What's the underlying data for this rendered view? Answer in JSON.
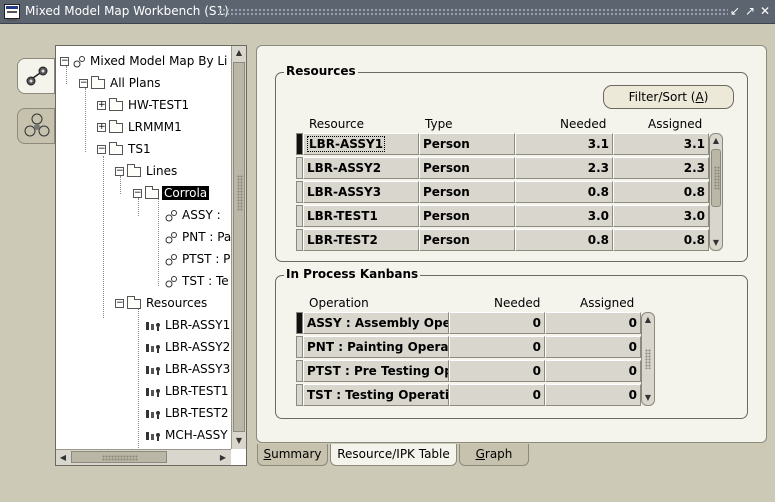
{
  "window": {
    "title": "Mixed Model Map Workbench (S1)",
    "controls": [
      "minimize-icon",
      "maximize-icon",
      "close-icon"
    ]
  },
  "side_strip": [
    {
      "icon": "network-map-icon",
      "selected": true
    },
    {
      "icon": "cluster-map-icon",
      "selected": false
    }
  ],
  "tree": {
    "nodes": [
      {
        "label": "Mixed Model Map By Li",
        "icon": "gear-icon",
        "expander": "-"
      },
      {
        "label": "All Plans",
        "icon": "folder-icon",
        "expander": "-"
      },
      {
        "label": "HW-TEST1",
        "icon": "folder-icon",
        "expander": "+"
      },
      {
        "label": "LRMMM1",
        "icon": "folder-icon",
        "expander": "+"
      },
      {
        "label": "TS1",
        "icon": "folder-icon",
        "expander": "-"
      },
      {
        "label": "Lines",
        "icon": "folder-icon",
        "expander": "-"
      },
      {
        "label": "Corrola",
        "icon": "folder-icon",
        "expander": "-",
        "selected": true
      },
      {
        "label": "ASSY :",
        "icon": "gear-icon"
      },
      {
        "label": "PNT : Pa",
        "icon": "gear-icon"
      },
      {
        "label": "PTST : P",
        "icon": "gear-icon"
      },
      {
        "label": "TST : Te",
        "icon": "gear-icon"
      },
      {
        "label": "Resources",
        "icon": "folder-icon",
        "expander": "-"
      },
      {
        "label": "LBR-ASSY1",
        "icon": "resource-icon"
      },
      {
        "label": "LBR-ASSY2",
        "icon": "resource-icon"
      },
      {
        "label": "LBR-ASSY3",
        "icon": "resource-icon"
      },
      {
        "label": "LBR-TEST1",
        "icon": "resource-icon"
      },
      {
        "label": "LBR-TEST2",
        "icon": "resource-icon"
      },
      {
        "label": "MCH-ASSY",
        "icon": "resource-icon"
      }
    ]
  },
  "resources": {
    "section_label": "Resources",
    "filter_button": "Filter/Sort (A)",
    "filter_button_mnemonic": "A",
    "columns": [
      "Resource",
      "Type",
      "Needed",
      "Assigned"
    ],
    "rows": [
      {
        "resource": "LBR-ASSY1",
        "type": "Person",
        "needed": "3.1",
        "assigned": "3.1"
      },
      {
        "resource": "LBR-ASSY2",
        "type": "Person",
        "needed": "2.3",
        "assigned": "2.3"
      },
      {
        "resource": "LBR-ASSY3",
        "type": "Person",
        "needed": "0.8",
        "assigned": "0.8"
      },
      {
        "resource": "LBR-TEST1",
        "type": "Person",
        "needed": "3.0",
        "assigned": "3.0"
      },
      {
        "resource": "LBR-TEST2",
        "type": "Person",
        "needed": "0.8",
        "assigned": "0.8"
      }
    ]
  },
  "kanbans": {
    "section_label": "In Process Kanbans",
    "columns": [
      "Operation",
      "Needed",
      "Assigned"
    ],
    "rows": [
      {
        "operation": "ASSY : Assembly Oper",
        "needed": "0",
        "assigned": "0"
      },
      {
        "operation": "PNT : Painting Operat",
        "needed": "0",
        "assigned": "0"
      },
      {
        "operation": "PTST : Pre Testing Op",
        "needed": "0",
        "assigned": "0"
      },
      {
        "operation": "TST : Testing Operatic",
        "needed": "0",
        "assigned": "0"
      }
    ]
  },
  "tabs": [
    {
      "label": "Summary",
      "mnemonic": "S",
      "active": false
    },
    {
      "label": "Resource/IPK Table",
      "mnemonic": "",
      "active": true
    },
    {
      "label": "Graph",
      "mnemonic": "G",
      "active": false
    }
  ],
  "colors": {
    "window_bg": "#ccc9b7",
    "panel_bg": "#f4f3ec",
    "title_bar": "#5c6470",
    "cell_bg": "#d8d6cd"
  }
}
